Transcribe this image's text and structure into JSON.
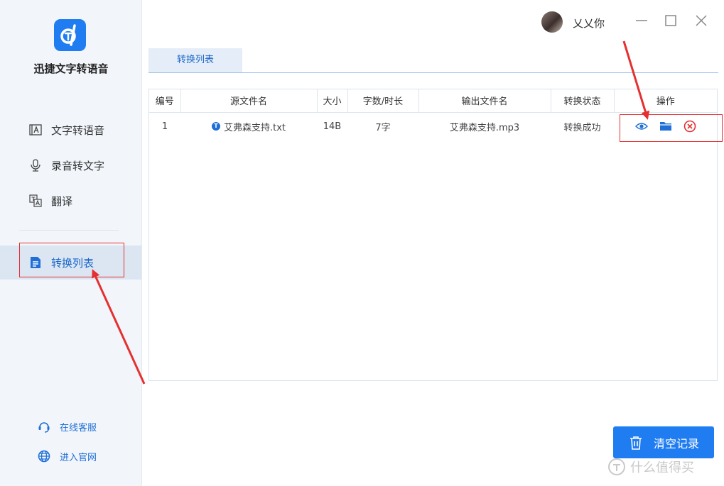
{
  "app": {
    "title": "迅捷文字转语音",
    "logo_color": "#1f7cf1"
  },
  "sidebar": {
    "items": [
      {
        "label": "文字转语音",
        "icon": "text-to-speech-icon",
        "active": false
      },
      {
        "label": "录音转文字",
        "icon": "microphone-icon",
        "active": false
      },
      {
        "label": "翻译",
        "icon": "translate-icon",
        "active": false
      },
      {
        "label": "转换列表",
        "icon": "conversion-list-icon",
        "active": true
      }
    ],
    "bottom_links": [
      {
        "label": "在线客服",
        "icon": "customer-service-icon"
      },
      {
        "label": "进入官网",
        "icon": "globe-icon"
      }
    ]
  },
  "user": {
    "name": "乂乂你"
  },
  "tabs": [
    {
      "label": "转换列表",
      "active": true
    }
  ],
  "table": {
    "columns": [
      "编号",
      "源文件名",
      "大小",
      "字数/时长",
      "输出文件名",
      "转换状态",
      "操作"
    ],
    "rows": [
      {
        "index": "1",
        "source": "艾弗森支持.txt",
        "size": "14B",
        "length": "7字",
        "output": "艾弗森支持.mp3",
        "status": "转换成功",
        "actions": [
          "eye-icon",
          "folder-icon",
          "delete-circle-icon"
        ]
      }
    ]
  },
  "clear_button": {
    "label": "清空记录"
  },
  "watermark": {
    "text": "什么值得买"
  },
  "colors": {
    "accent": "#1f7cf1",
    "annotation_red": "#e53030",
    "delete_red": "#e53030"
  }
}
